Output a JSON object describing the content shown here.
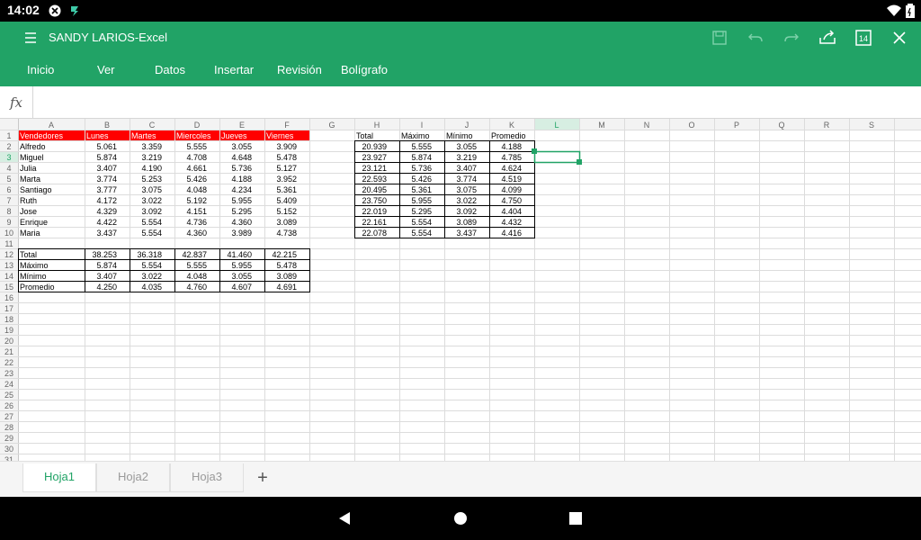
{
  "status": {
    "time": "14:02"
  },
  "app": {
    "title": "SANDY LARIOS-Excel",
    "page_number_icon": "14"
  },
  "ribbon": {
    "tabs": [
      "Inicio",
      "Ver",
      "Datos",
      "Insertar",
      "Revisión",
      "Bolígrafo"
    ]
  },
  "formula_bar": {
    "label": "fx",
    "value": ""
  },
  "grid": {
    "columns": [
      "A",
      "B",
      "C",
      "D",
      "E",
      "F",
      "G",
      "H",
      "I",
      "J",
      "K",
      "L",
      "M",
      "N",
      "O",
      "P",
      "Q",
      "R",
      "S"
    ],
    "selected_column": "L",
    "selected_row": "3",
    "row_count": 31,
    "header_fill": "#ff0000",
    "accent": "#21a366",
    "cells": [
      [
        "1",
        "A",
        "Vendedores",
        "l",
        "hdr"
      ],
      [
        "1",
        "B",
        "Lunes",
        "l",
        "hdr"
      ],
      [
        "1",
        "C",
        "Martes",
        "l",
        "hdr"
      ],
      [
        "1",
        "D",
        "Miercoles",
        "l",
        "hdr"
      ],
      [
        "1",
        "E",
        "Jueves",
        "l",
        "hdr"
      ],
      [
        "1",
        "F",
        "Viernes",
        "l",
        "hdr"
      ],
      [
        "1",
        "H",
        "Total",
        "l",
        ""
      ],
      [
        "1",
        "I",
        "Máximo",
        "l",
        ""
      ],
      [
        "1",
        "J",
        "Mínimo",
        "l",
        ""
      ],
      [
        "1",
        "K",
        "Promedio",
        "l",
        ""
      ],
      [
        "2",
        "A",
        "Alfredo",
        "l",
        ""
      ],
      [
        "2",
        "B",
        "5.061",
        "r",
        ""
      ],
      [
        "2",
        "C",
        "3.359",
        "r",
        ""
      ],
      [
        "2",
        "D",
        "5.555",
        "r",
        ""
      ],
      [
        "2",
        "E",
        "3.055",
        "r",
        ""
      ],
      [
        "2",
        "F",
        "3.909",
        "r",
        ""
      ],
      [
        "3",
        "A",
        "Miguel",
        "l",
        ""
      ],
      [
        "3",
        "B",
        "5.874",
        "r",
        ""
      ],
      [
        "3",
        "C",
        "3.219",
        "r",
        ""
      ],
      [
        "3",
        "D",
        "4.708",
        "r",
        ""
      ],
      [
        "3",
        "E",
        "4.648",
        "r",
        ""
      ],
      [
        "3",
        "F",
        "5.478",
        "r",
        ""
      ],
      [
        "4",
        "A",
        "Julia",
        "l",
        ""
      ],
      [
        "4",
        "B",
        "3.407",
        "r",
        ""
      ],
      [
        "4",
        "C",
        "4.190",
        "r",
        ""
      ],
      [
        "4",
        "D",
        "4.661",
        "r",
        ""
      ],
      [
        "4",
        "E",
        "5.736",
        "r",
        ""
      ],
      [
        "4",
        "F",
        "5.127",
        "r",
        ""
      ],
      [
        "5",
        "A",
        "Marta",
        "l",
        ""
      ],
      [
        "5",
        "B",
        "3.774",
        "r",
        ""
      ],
      [
        "5",
        "C",
        "5.253",
        "r",
        ""
      ],
      [
        "5",
        "D",
        "5.426",
        "r",
        ""
      ],
      [
        "5",
        "E",
        "4.188",
        "r",
        ""
      ],
      [
        "5",
        "F",
        "3.952",
        "r",
        ""
      ],
      [
        "6",
        "A",
        "Santiago",
        "l",
        ""
      ],
      [
        "6",
        "B",
        "3.777",
        "r",
        ""
      ],
      [
        "6",
        "C",
        "3.075",
        "r",
        ""
      ],
      [
        "6",
        "D",
        "4.048",
        "r",
        ""
      ],
      [
        "6",
        "E",
        "4.234",
        "r",
        ""
      ],
      [
        "6",
        "F",
        "5.361",
        "r",
        ""
      ],
      [
        "7",
        "A",
        "Ruth",
        "l",
        ""
      ],
      [
        "7",
        "B",
        "4.172",
        "r",
        ""
      ],
      [
        "7",
        "C",
        "3.022",
        "r",
        ""
      ],
      [
        "7",
        "D",
        "5.192",
        "r",
        ""
      ],
      [
        "7",
        "E",
        "5.955",
        "r",
        ""
      ],
      [
        "7",
        "F",
        "5.409",
        "r",
        ""
      ],
      [
        "8",
        "A",
        "Jose",
        "l",
        ""
      ],
      [
        "8",
        "B",
        "4.329",
        "r",
        ""
      ],
      [
        "8",
        "C",
        "3.092",
        "r",
        ""
      ],
      [
        "8",
        "D",
        "4.151",
        "r",
        ""
      ],
      [
        "8",
        "E",
        "5.295",
        "r",
        ""
      ],
      [
        "8",
        "F",
        "5.152",
        "r",
        ""
      ],
      [
        "9",
        "A",
        "Enrique",
        "l",
        ""
      ],
      [
        "9",
        "B",
        "4.422",
        "r",
        ""
      ],
      [
        "9",
        "C",
        "5.554",
        "r",
        ""
      ],
      [
        "9",
        "D",
        "4.736",
        "r",
        ""
      ],
      [
        "9",
        "E",
        "4.360",
        "r",
        ""
      ],
      [
        "9",
        "F",
        "3.089",
        "r",
        ""
      ],
      [
        "10",
        "A",
        "Maria",
        "l",
        ""
      ],
      [
        "10",
        "B",
        "3.437",
        "r",
        ""
      ],
      [
        "10",
        "C",
        "5.554",
        "r",
        ""
      ],
      [
        "10",
        "D",
        "4.360",
        "r",
        ""
      ],
      [
        "10",
        "E",
        "3.989",
        "r",
        ""
      ],
      [
        "10",
        "F",
        "4.738",
        "r",
        ""
      ],
      [
        "2",
        "H",
        "20.939",
        "r",
        ""
      ],
      [
        "2",
        "I",
        "5.555",
        "r",
        ""
      ],
      [
        "2",
        "J",
        "3.055",
        "r",
        ""
      ],
      [
        "2",
        "K",
        "4.188",
        "r",
        ""
      ],
      [
        "3",
        "H",
        "23.927",
        "r",
        ""
      ],
      [
        "3",
        "I",
        "5.874",
        "r",
        ""
      ],
      [
        "3",
        "J",
        "3.219",
        "r",
        ""
      ],
      [
        "3",
        "K",
        "4.785",
        "r",
        ""
      ],
      [
        "4",
        "H",
        "23.121",
        "r",
        ""
      ],
      [
        "4",
        "I",
        "5.736",
        "r",
        ""
      ],
      [
        "4",
        "J",
        "3.407",
        "r",
        ""
      ],
      [
        "4",
        "K",
        "4.624",
        "r",
        ""
      ],
      [
        "5",
        "H",
        "22.593",
        "r",
        ""
      ],
      [
        "5",
        "I",
        "5.426",
        "r",
        ""
      ],
      [
        "5",
        "J",
        "3.774",
        "r",
        ""
      ],
      [
        "5",
        "K",
        "4.519",
        "r",
        ""
      ],
      [
        "6",
        "H",
        "20.495",
        "r",
        ""
      ],
      [
        "6",
        "I",
        "5.361",
        "r",
        ""
      ],
      [
        "6",
        "J",
        "3.075",
        "r",
        ""
      ],
      [
        "6",
        "K",
        "4.099",
        "r",
        ""
      ],
      [
        "7",
        "H",
        "23.750",
        "r",
        ""
      ],
      [
        "7",
        "I",
        "5.955",
        "r",
        ""
      ],
      [
        "7",
        "J",
        "3.022",
        "r",
        ""
      ],
      [
        "7",
        "K",
        "4.750",
        "r",
        ""
      ],
      [
        "8",
        "H",
        "22.019",
        "r",
        ""
      ],
      [
        "8",
        "I",
        "5.295",
        "r",
        ""
      ],
      [
        "8",
        "J",
        "3.092",
        "r",
        ""
      ],
      [
        "8",
        "K",
        "4.404",
        "r",
        ""
      ],
      [
        "9",
        "H",
        "22.161",
        "r",
        ""
      ],
      [
        "9",
        "I",
        "5.554",
        "r",
        ""
      ],
      [
        "9",
        "J",
        "3.089",
        "r",
        ""
      ],
      [
        "9",
        "K",
        "4.432",
        "r",
        ""
      ],
      [
        "10",
        "H",
        "22.078",
        "r",
        ""
      ],
      [
        "10",
        "I",
        "5.554",
        "r",
        ""
      ],
      [
        "10",
        "J",
        "3.437",
        "r",
        ""
      ],
      [
        "10",
        "K",
        "4.416",
        "r",
        ""
      ],
      [
        "12",
        "A",
        "Total",
        "l",
        ""
      ],
      [
        "12",
        "B",
        "38.253",
        "r",
        ""
      ],
      [
        "12",
        "C",
        "36.318",
        "r",
        ""
      ],
      [
        "12",
        "D",
        "42.837",
        "r",
        ""
      ],
      [
        "12",
        "E",
        "41.460",
        "r",
        ""
      ],
      [
        "12",
        "F",
        "42.215",
        "r",
        ""
      ],
      [
        "13",
        "A",
        "Máximo",
        "l",
        ""
      ],
      [
        "13",
        "B",
        "5.874",
        "r",
        ""
      ],
      [
        "13",
        "C",
        "5.554",
        "r",
        ""
      ],
      [
        "13",
        "D",
        "5.555",
        "r",
        ""
      ],
      [
        "13",
        "E",
        "5.955",
        "r",
        ""
      ],
      [
        "13",
        "F",
        "5.478",
        "r",
        ""
      ],
      [
        "14",
        "A",
        "Mínimo",
        "l",
        ""
      ],
      [
        "14",
        "B",
        "3.407",
        "r",
        ""
      ],
      [
        "14",
        "C",
        "3.022",
        "r",
        ""
      ],
      [
        "14",
        "D",
        "4.048",
        "r",
        ""
      ],
      [
        "14",
        "E",
        "3.055",
        "r",
        ""
      ],
      [
        "14",
        "F",
        "3.089",
        "r",
        ""
      ],
      [
        "15",
        "A",
        "Promedio",
        "l",
        ""
      ],
      [
        "15",
        "B",
        "4.250",
        "r",
        ""
      ],
      [
        "15",
        "C",
        "4.035",
        "r",
        ""
      ],
      [
        "15",
        "D",
        "4.760",
        "r",
        ""
      ],
      [
        "15",
        "E",
        "4.607",
        "r",
        ""
      ],
      [
        "15",
        "F",
        "4.691",
        "r",
        ""
      ]
    ],
    "bordered_blocks": [
      {
        "c1": "H",
        "c2": "K",
        "r1": "2",
        "r2": "10"
      },
      {
        "c1": "A",
        "c2": "F",
        "r1": "12",
        "r2": "15"
      }
    ]
  },
  "sheets": {
    "tabs": [
      "Hoja1",
      "Hoja2",
      "Hoja3"
    ],
    "active": "Hoja1",
    "add_label": "+"
  },
  "icons": {
    "status_left": [
      "photo-notification-icon",
      "flash-notification-icon"
    ],
    "status_right": [
      "wifi-icon",
      "battery-icon"
    ],
    "titlebar": [
      "save-icon",
      "undo-icon",
      "redo-icon",
      "share-icon",
      "page-icon",
      "close-icon"
    ],
    "nav": [
      "back-icon",
      "home-icon",
      "recents-icon"
    ]
  }
}
